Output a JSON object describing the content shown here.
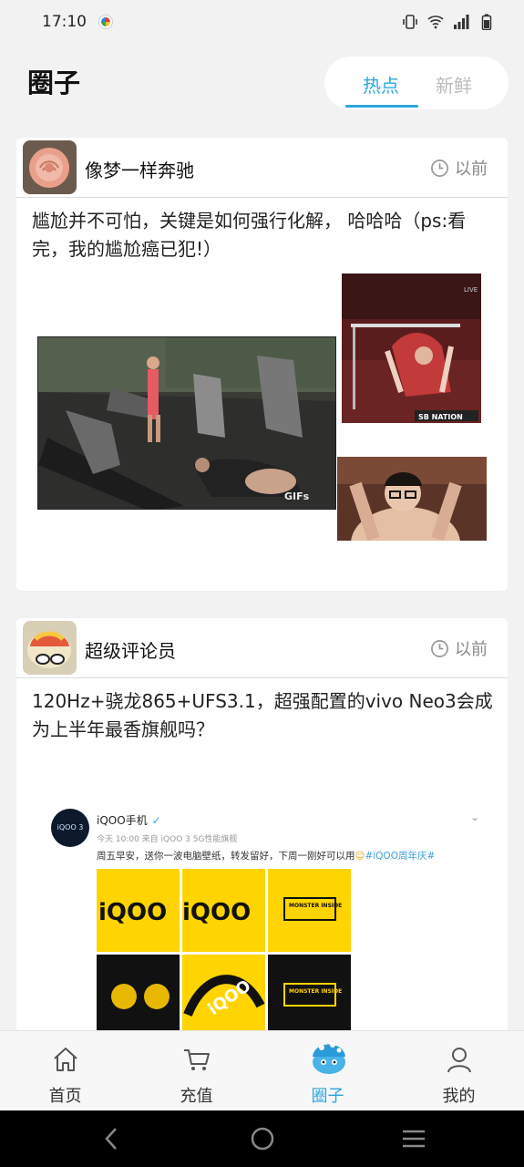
{
  "status_bar": {
    "time": "17:10"
  },
  "header": {
    "title": "圈子",
    "tabs": [
      {
        "label": "热点",
        "active": true
      },
      {
        "label": "新鲜",
        "active": false
      }
    ]
  },
  "posts": [
    {
      "username": "像梦一样奔驰",
      "time": "以前",
      "text": "尴尬并不可怕，关键是如何强行化解， 哈哈哈（ps:看完，我的尴尬癌已犯!）",
      "image_captions": [
        "GIFs",
        "SB NATION",
        "LIVE"
      ]
    },
    {
      "username": "超级评论员",
      "time": "以前",
      "text": "120Hz+骁龙865+UFS3.1，超强配置的vivo Neo3会成为上半年最香旗舰吗？",
      "embed": {
        "account": "iQOO手机",
        "meta": "今天 10:00 来自 iQOO 3 5G性能旗舰",
        "body": "周五早安，送你一波电脑壁纸，转发留好，下周一刚好可以用",
        "hashtag": "#iQOO周年庆#",
        "tile_text": "MONSTER INSIDE",
        "logo_text": "iQOO 3"
      }
    }
  ],
  "bottom_nav": [
    {
      "label": "首页"
    },
    {
      "label": "充值"
    },
    {
      "label": "圈子"
    },
    {
      "label": "我的"
    }
  ],
  "colors": {
    "accent": "#2aa7e0",
    "iqoo_yellow": "#ffd400"
  }
}
